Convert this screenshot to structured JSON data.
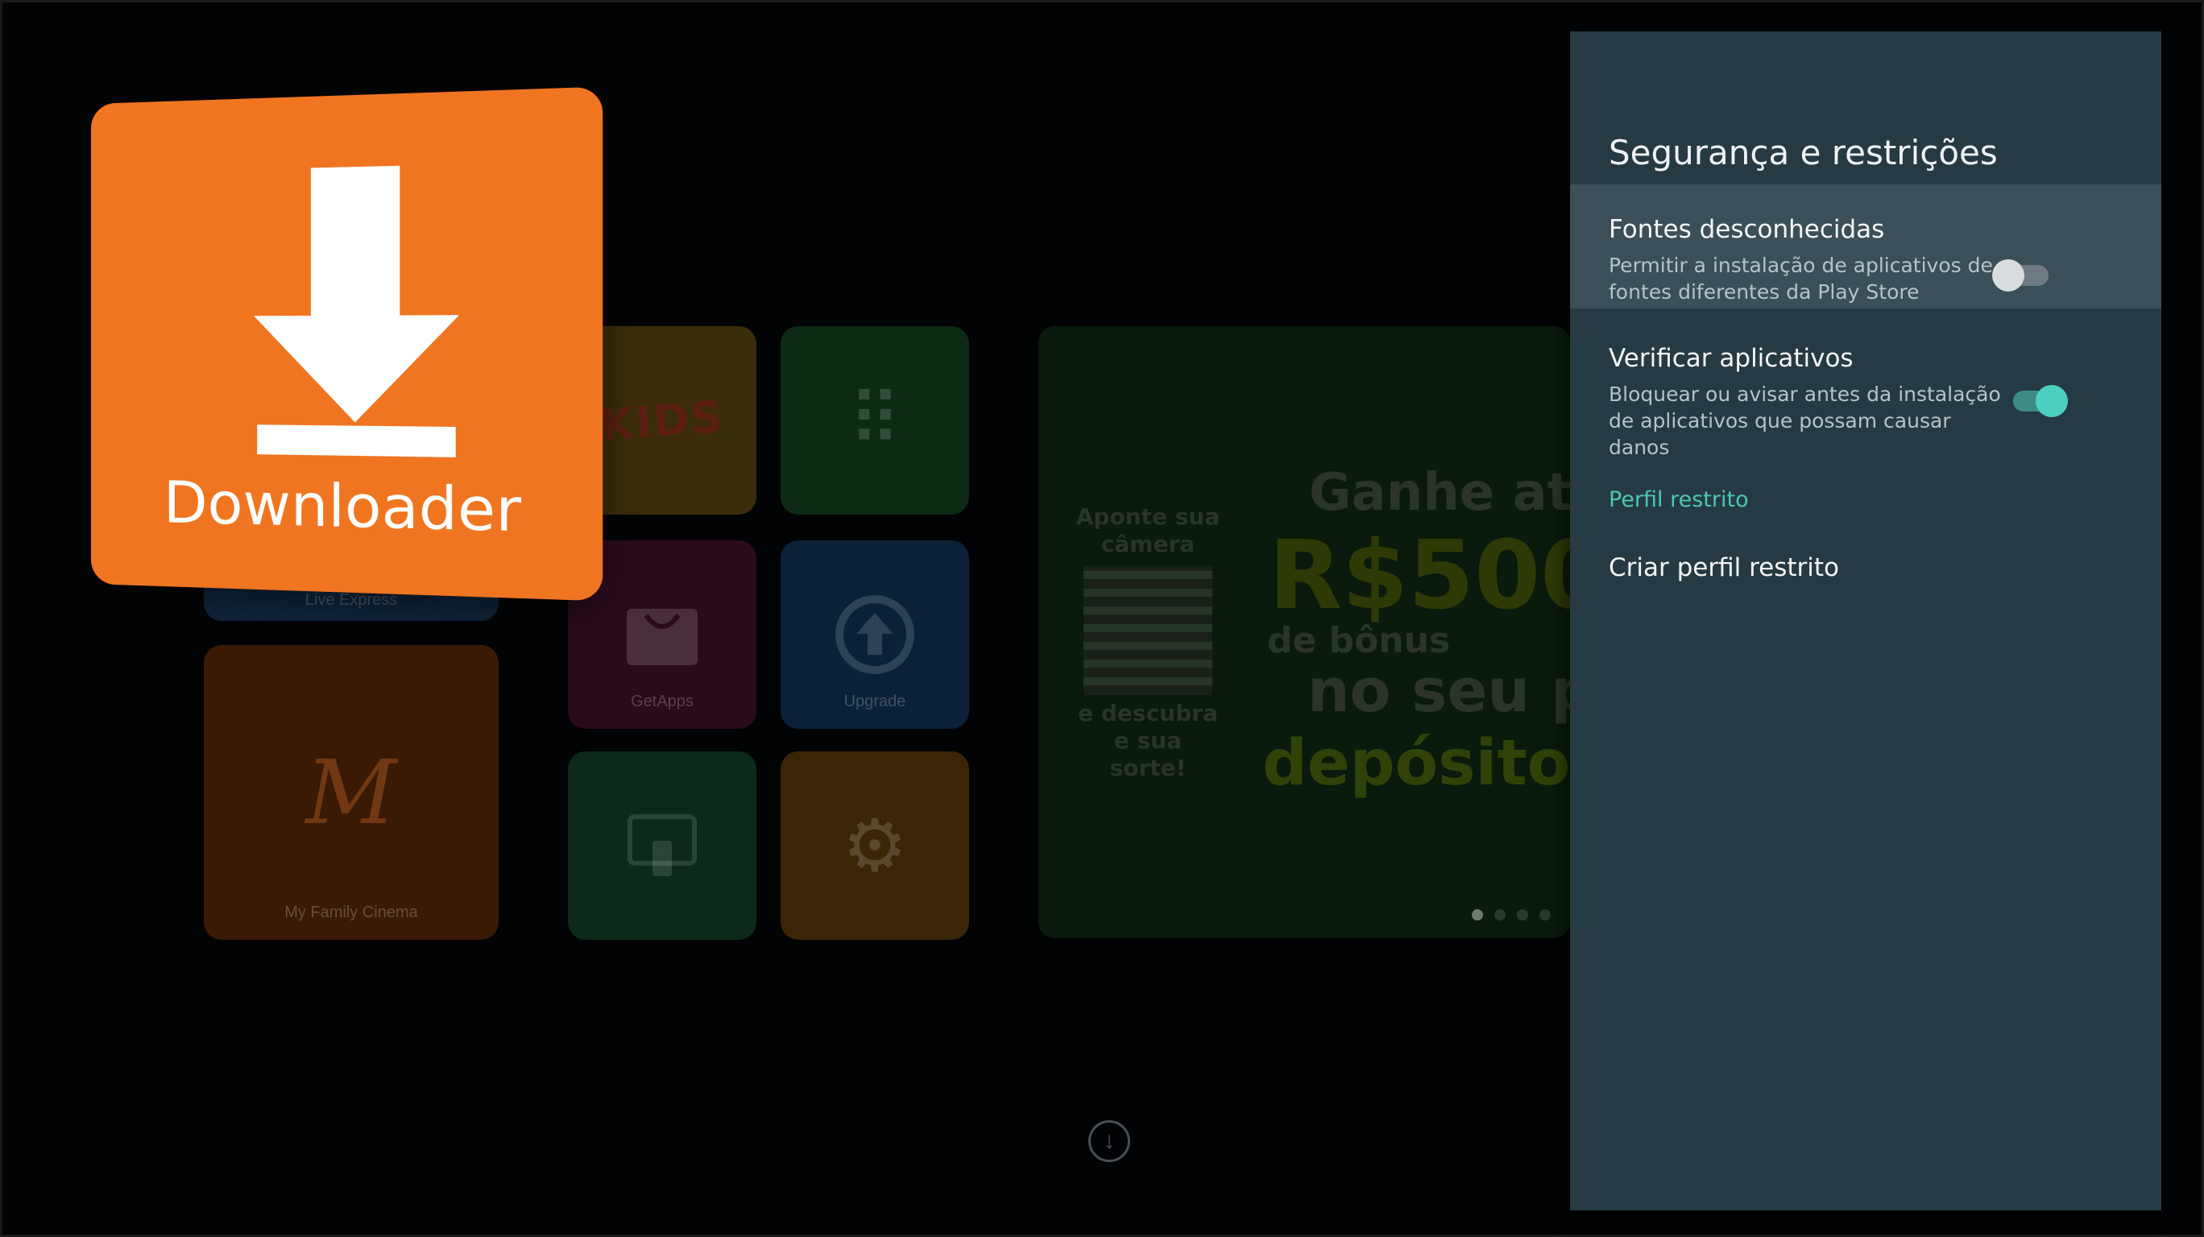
{
  "launcher": {
    "tiles": {
      "live": "Live Express",
      "kids_logo": "KIDS",
      "getapps": "GetApps",
      "upgrade": "Upgrade",
      "family": "My Family Cinema"
    },
    "banner": {
      "qr_top": "Aponte sua câmera",
      "qr_bottom": "e descubra e sua sorte!",
      "line1": "Ganhe at",
      "line2": "R$500",
      "line3": "de bônus",
      "line4": "no seu p",
      "line5": "depósito!"
    },
    "focused_app": "Downloader"
  },
  "panel": {
    "title": "Segurança e restrições",
    "items": [
      {
        "title": "Fontes desconhecidas",
        "subtitle": "Permitir a instalação de aplicativos de fontes diferentes da Play Store",
        "toggle": "off"
      },
      {
        "title": "Verificar aplicativos",
        "subtitle": "Bloquear ou avisar antes da instalação de aplicativos que possam causar danos",
        "toggle": "on"
      }
    ],
    "section": "Perfil restrito",
    "create": "Criar perfil restrito"
  },
  "colors": {
    "accent": "#4dd0c0",
    "panel_bg": "#263a43",
    "downloader_orange": "#f07520"
  },
  "icons": [
    "download-arrow-icon",
    "shopping-bag-icon",
    "upgrade-icon",
    "cast-icon",
    "gear-icon",
    "scroll-down-icon"
  ]
}
